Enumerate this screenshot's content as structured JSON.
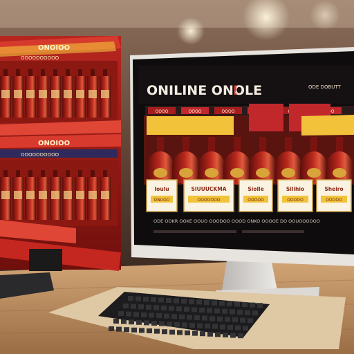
{
  "screen": {
    "heading": "ONILINE ONOLE",
    "heading_mark": "!",
    "top_right_text": "ODE DOBUTT",
    "banner_left": "",
    "banner_right": "",
    "top_tags": [
      "OOOO",
      "OOOO",
      "OOOO",
      "OOOO",
      "OOOO",
      "OOOO"
    ],
    "labels": [
      {
        "name": "Ioulu",
        "sub": "ONUOO"
      },
      {
        "name": "SIUUUCKMA",
        "sub": "OOOOOOO"
      },
      {
        "name": "Siolle",
        "sub": "OOOOO"
      },
      {
        "name": "Silihio",
        "sub": "OOOOO"
      },
      {
        "name": "Sheiro",
        "sub": "OOOOO"
      }
    ],
    "footer_text": "ODE OOKR OOKE OOUO OOODOO OOOD ONKO OOOOE DO OOUOOOOOO"
  },
  "side_display": {
    "shelf_signs": [
      "ONOIOO",
      "ONOIOO"
    ],
    "shelf_tickers": [
      "OOOOOOOOOO",
      "OOOOOOOOOO"
    ]
  },
  "colors": {
    "screen_bg": "#1a1415",
    "banner_red": "#c0282c",
    "banner_yellow": "#f2c23a",
    "bottle_red": "#9b1a14",
    "wood": "#c59a6b",
    "wall": "#6e5343"
  }
}
